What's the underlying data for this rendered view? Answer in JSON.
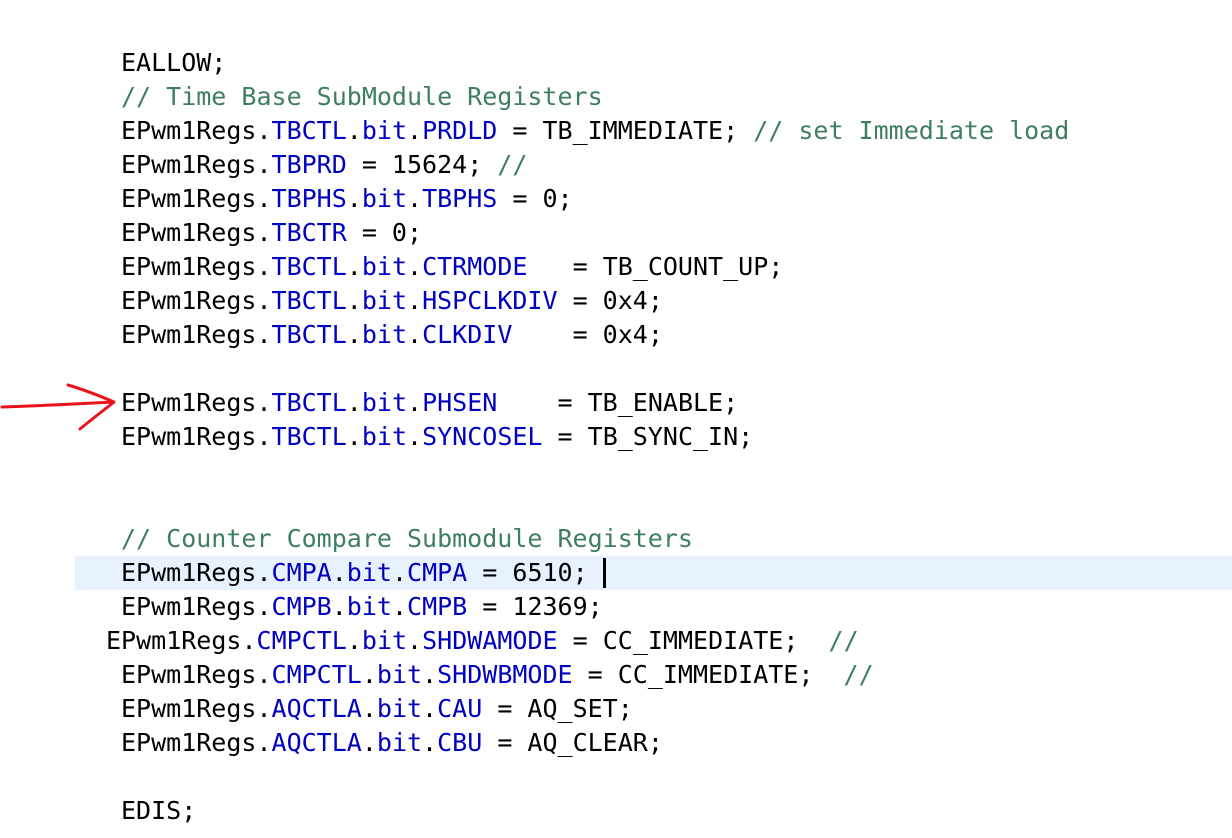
{
  "editor": {
    "colors": {
      "text": "#000000",
      "field": "#0000c0",
      "comment": "#3f7f5f",
      "current_line_bg": "#e8f2fe",
      "annotation": "#e8141b"
    },
    "current_line_index": 15,
    "lines": [
      {
        "tokens": [
          {
            "text": "EALLOW;",
            "kind": "plain"
          }
        ]
      },
      {
        "tokens": [
          {
            "text": "// Time Base SubModule Registers",
            "kind": "comment"
          }
        ]
      },
      {
        "tokens": [
          {
            "text": "EPwm1Regs.",
            "kind": "plain"
          },
          {
            "text": "TBCTL",
            "kind": "field"
          },
          {
            "text": ".",
            "kind": "plain"
          },
          {
            "text": "bit",
            "kind": "field"
          },
          {
            "text": ".",
            "kind": "plain"
          },
          {
            "text": "PRDLD",
            "kind": "field"
          },
          {
            "text": " = TB_IMMEDIATE; ",
            "kind": "plain"
          },
          {
            "text": "// set Immediate load",
            "kind": "comment"
          }
        ]
      },
      {
        "tokens": [
          {
            "text": "EPwm1Regs.",
            "kind": "plain"
          },
          {
            "text": "TBPRD",
            "kind": "field"
          },
          {
            "text": " = 15624; ",
            "kind": "plain"
          },
          {
            "text": "//",
            "kind": "comment"
          }
        ]
      },
      {
        "tokens": [
          {
            "text": "EPwm1Regs.",
            "kind": "plain"
          },
          {
            "text": "TBPHS",
            "kind": "field"
          },
          {
            "text": ".",
            "kind": "plain"
          },
          {
            "text": "bit",
            "kind": "field"
          },
          {
            "text": ".",
            "kind": "plain"
          },
          {
            "text": "TBPHS",
            "kind": "field"
          },
          {
            "text": " = 0;",
            "kind": "plain"
          }
        ]
      },
      {
        "tokens": [
          {
            "text": "EPwm1Regs.",
            "kind": "plain"
          },
          {
            "text": "TBCTR",
            "kind": "field"
          },
          {
            "text": " = 0;",
            "kind": "plain"
          }
        ]
      },
      {
        "tokens": [
          {
            "text": "EPwm1Regs.",
            "kind": "plain"
          },
          {
            "text": "TBCTL",
            "kind": "field"
          },
          {
            "text": ".",
            "kind": "plain"
          },
          {
            "text": "bit",
            "kind": "field"
          },
          {
            "text": ".",
            "kind": "plain"
          },
          {
            "text": "CTRMODE",
            "kind": "field"
          },
          {
            "text": "   = TB_COUNT_UP;",
            "kind": "plain"
          }
        ]
      },
      {
        "tokens": [
          {
            "text": "EPwm1Regs.",
            "kind": "plain"
          },
          {
            "text": "TBCTL",
            "kind": "field"
          },
          {
            "text": ".",
            "kind": "plain"
          },
          {
            "text": "bit",
            "kind": "field"
          },
          {
            "text": ".",
            "kind": "plain"
          },
          {
            "text": "HSPCLKDIV",
            "kind": "field"
          },
          {
            "text": " = 0x4;",
            "kind": "plain"
          }
        ]
      },
      {
        "tokens": [
          {
            "text": "EPwm1Regs.",
            "kind": "plain"
          },
          {
            "text": "TBCTL",
            "kind": "field"
          },
          {
            "text": ".",
            "kind": "plain"
          },
          {
            "text": "bit",
            "kind": "field"
          },
          {
            "text": ".",
            "kind": "plain"
          },
          {
            "text": "CLKDIV",
            "kind": "field"
          },
          {
            "text": "    = 0x4;",
            "kind": "plain"
          }
        ]
      },
      {
        "tokens": []
      },
      {
        "tokens": [
          {
            "text": "EPwm1Regs.",
            "kind": "plain"
          },
          {
            "text": "TBCTL",
            "kind": "field"
          },
          {
            "text": ".",
            "kind": "plain"
          },
          {
            "text": "bit",
            "kind": "field"
          },
          {
            "text": ".",
            "kind": "plain"
          },
          {
            "text": "PHSEN",
            "kind": "field"
          },
          {
            "text": "    = TB_ENABLE;",
            "kind": "plain"
          }
        ]
      },
      {
        "tokens": [
          {
            "text": "EPwm1Regs.",
            "kind": "plain"
          },
          {
            "text": "TBCTL",
            "kind": "field"
          },
          {
            "text": ".",
            "kind": "plain"
          },
          {
            "text": "bit",
            "kind": "field"
          },
          {
            "text": ".",
            "kind": "plain"
          },
          {
            "text": "SYNCOSEL",
            "kind": "field"
          },
          {
            "text": " = TB_SYNC_IN;",
            "kind": "plain"
          }
        ]
      },
      {
        "tokens": []
      },
      {
        "tokens": []
      },
      {
        "tokens": [
          {
            "text": "// Counter Compare Submodule Registers",
            "kind": "comment"
          }
        ]
      },
      {
        "tokens": [
          {
            "text": "EPwm1Regs.",
            "kind": "plain"
          },
          {
            "text": "CMPA",
            "kind": "field"
          },
          {
            "text": ".",
            "kind": "plain"
          },
          {
            "text": "bit",
            "kind": "field"
          },
          {
            "text": ".",
            "kind": "plain"
          },
          {
            "text": "CMPA",
            "kind": "field"
          },
          {
            "text": " = 6510; ",
            "kind": "plain"
          }
        ]
      },
      {
        "tokens": [
          {
            "text": "EPwm1Regs.",
            "kind": "plain"
          },
          {
            "text": "CMPB",
            "kind": "field"
          },
          {
            "text": ".",
            "kind": "plain"
          },
          {
            "text": "bit",
            "kind": "field"
          },
          {
            "text": ".",
            "kind": "plain"
          },
          {
            "text": "CMPB",
            "kind": "field"
          },
          {
            "text": " = 12369;",
            "kind": "plain"
          }
        ]
      },
      {
        "tokens": [
          {
            "text": "EPwm1Regs.",
            "kind": "plain"
          },
          {
            "text": "CMPCTL",
            "kind": "field"
          },
          {
            "text": ".",
            "kind": "plain"
          },
          {
            "text": "bit",
            "kind": "field"
          },
          {
            "text": ".",
            "kind": "plain"
          },
          {
            "text": "SHDWAMODE",
            "kind": "field"
          },
          {
            "text": " = CC_IMMEDIATE;  ",
            "kind": "plain"
          },
          {
            "text": "//",
            "kind": "comment"
          }
        ]
      },
      {
        "tokens": [
          {
            "text": "EPwm1Regs.",
            "kind": "plain"
          },
          {
            "text": "CMPCTL",
            "kind": "field"
          },
          {
            "text": ".",
            "kind": "plain"
          },
          {
            "text": "bit",
            "kind": "field"
          },
          {
            "text": ".",
            "kind": "plain"
          },
          {
            "text": "SHDWBMODE",
            "kind": "field"
          },
          {
            "text": " = CC_IMMEDIATE;  ",
            "kind": "plain"
          },
          {
            "text": "//",
            "kind": "comment"
          }
        ]
      },
      {
        "tokens": [
          {
            "text": "EPwm1Regs.",
            "kind": "plain"
          },
          {
            "text": "AQCTLA",
            "kind": "field"
          },
          {
            "text": ".",
            "kind": "plain"
          },
          {
            "text": "bit",
            "kind": "field"
          },
          {
            "text": ".",
            "kind": "plain"
          },
          {
            "text": "CAU",
            "kind": "field"
          },
          {
            "text": " = AQ_SET;",
            "kind": "plain"
          }
        ]
      },
      {
        "tokens": [
          {
            "text": "EPwm1Regs.",
            "kind": "plain"
          },
          {
            "text": "AQCTLA",
            "kind": "field"
          },
          {
            "text": ".",
            "kind": "plain"
          },
          {
            "text": "bit",
            "kind": "field"
          },
          {
            "text": ".",
            "kind": "plain"
          },
          {
            "text": "CBU",
            "kind": "field"
          },
          {
            "text": " = AQ_CLEAR;",
            "kind": "plain"
          }
        ]
      },
      {
        "tokens": []
      },
      {
        "tokens": [
          {
            "text": "EDIS;",
            "kind": "plain"
          }
        ]
      }
    ]
  }
}
